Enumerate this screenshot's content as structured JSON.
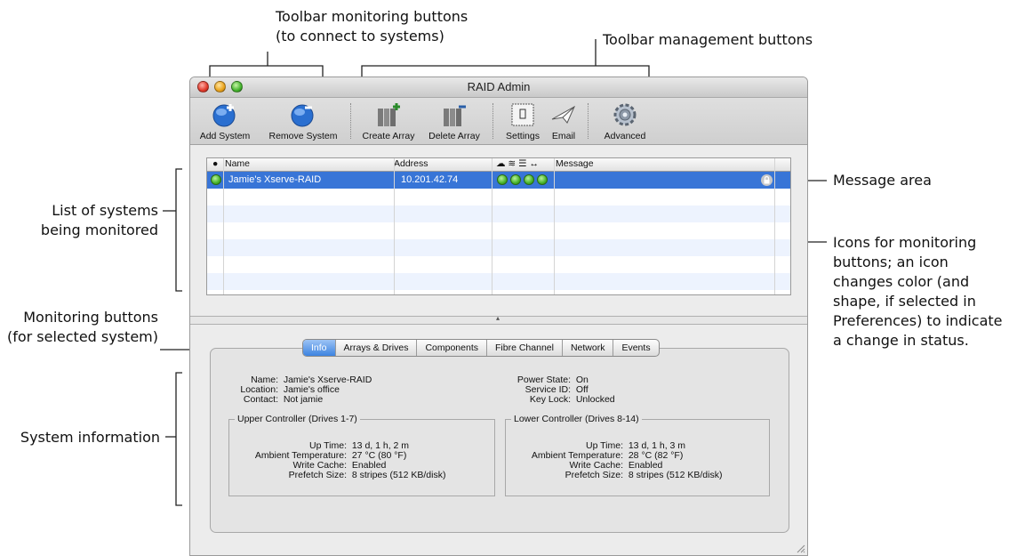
{
  "callouts": {
    "toolbar_monitoring": [
      "Toolbar monitoring buttons",
      "(to connect to systems)"
    ],
    "toolbar_management": "Toolbar management buttons",
    "message_area": "Message area",
    "list_of_systems": [
      "List of systems",
      "being monitored"
    ],
    "icons_for_monitoring": [
      "Icons for monitoring",
      "buttons; an icon",
      "changes color (and",
      "shape, if selected in",
      "Preferences) to indicate",
      "a change in status."
    ],
    "monitoring_buttons": [
      "Monitoring buttons",
      "(for selected system)"
    ],
    "system_information": "System information"
  },
  "window": {
    "title": "RAID Admin",
    "toolbar": [
      {
        "label": "Add System",
        "icon": "add-system-icon"
      },
      {
        "label": "Remove System",
        "icon": "remove-system-icon"
      },
      {
        "label": "Create Array",
        "icon": "create-array-icon"
      },
      {
        "label": "Delete Array",
        "icon": "delete-array-icon"
      },
      {
        "label": "Settings",
        "icon": "settings-icon"
      },
      {
        "label": "Email",
        "icon": "email-icon"
      },
      {
        "label": "Advanced",
        "icon": "advanced-gear-icon"
      }
    ],
    "list": {
      "columns": {
        "status": "●",
        "name": "Name",
        "address": "Address",
        "monitor_icons": "☁ ≋ ☰ ↔",
        "message": "Message"
      },
      "rows": [
        {
          "name": "Jamie's Xserve-RAID",
          "address": "10.201.42.74",
          "status": "green",
          "monitors": [
            "green",
            "green",
            "green",
            "green"
          ]
        }
      ]
    },
    "tabs": [
      "Info",
      "Arrays & Drives",
      "Components",
      "Fibre Channel",
      "Network",
      "Events"
    ],
    "active_tab": "Info",
    "info": {
      "left": [
        {
          "label": "Name:",
          "value": "Jamie's Xserve-RAID"
        },
        {
          "label": "Location:",
          "value": "Jamie's office"
        },
        {
          "label": "Contact:",
          "value": "Not jamie"
        }
      ],
      "right": [
        {
          "label": "Power State:",
          "value": "On"
        },
        {
          "label": "Service ID:",
          "value": "Off"
        },
        {
          "label": "Key Lock:",
          "value": "Unlocked"
        }
      ],
      "upper": {
        "title": "Upper Controller (Drives 1-7)",
        "rows": [
          {
            "label": "Up Time:",
            "value": "13 d, 1 h, 2 m"
          },
          {
            "label": "Ambient Temperature:",
            "value": "27 °C (80 °F)"
          },
          {
            "label": "Write Cache:",
            "value": "Enabled"
          },
          {
            "label": "Prefetch Size:",
            "value": "8 stripes (512 KB/disk)"
          }
        ]
      },
      "lower": {
        "title": "Lower Controller (Drives 8-14)",
        "rows": [
          {
            "label": "Up Time:",
            "value": "13 d, 1 h, 3 m"
          },
          {
            "label": "Ambient Temperature:",
            "value": "28 °C (82 °F)"
          },
          {
            "label": "Write Cache:",
            "value": "Enabled"
          },
          {
            "label": "Prefetch Size:",
            "value": "8 stripes (512 KB/disk)"
          }
        ]
      }
    }
  },
  "colors": {
    "selection": "#3875d7",
    "status_green": "#46b32a",
    "alt_row": "#edf3fe"
  }
}
